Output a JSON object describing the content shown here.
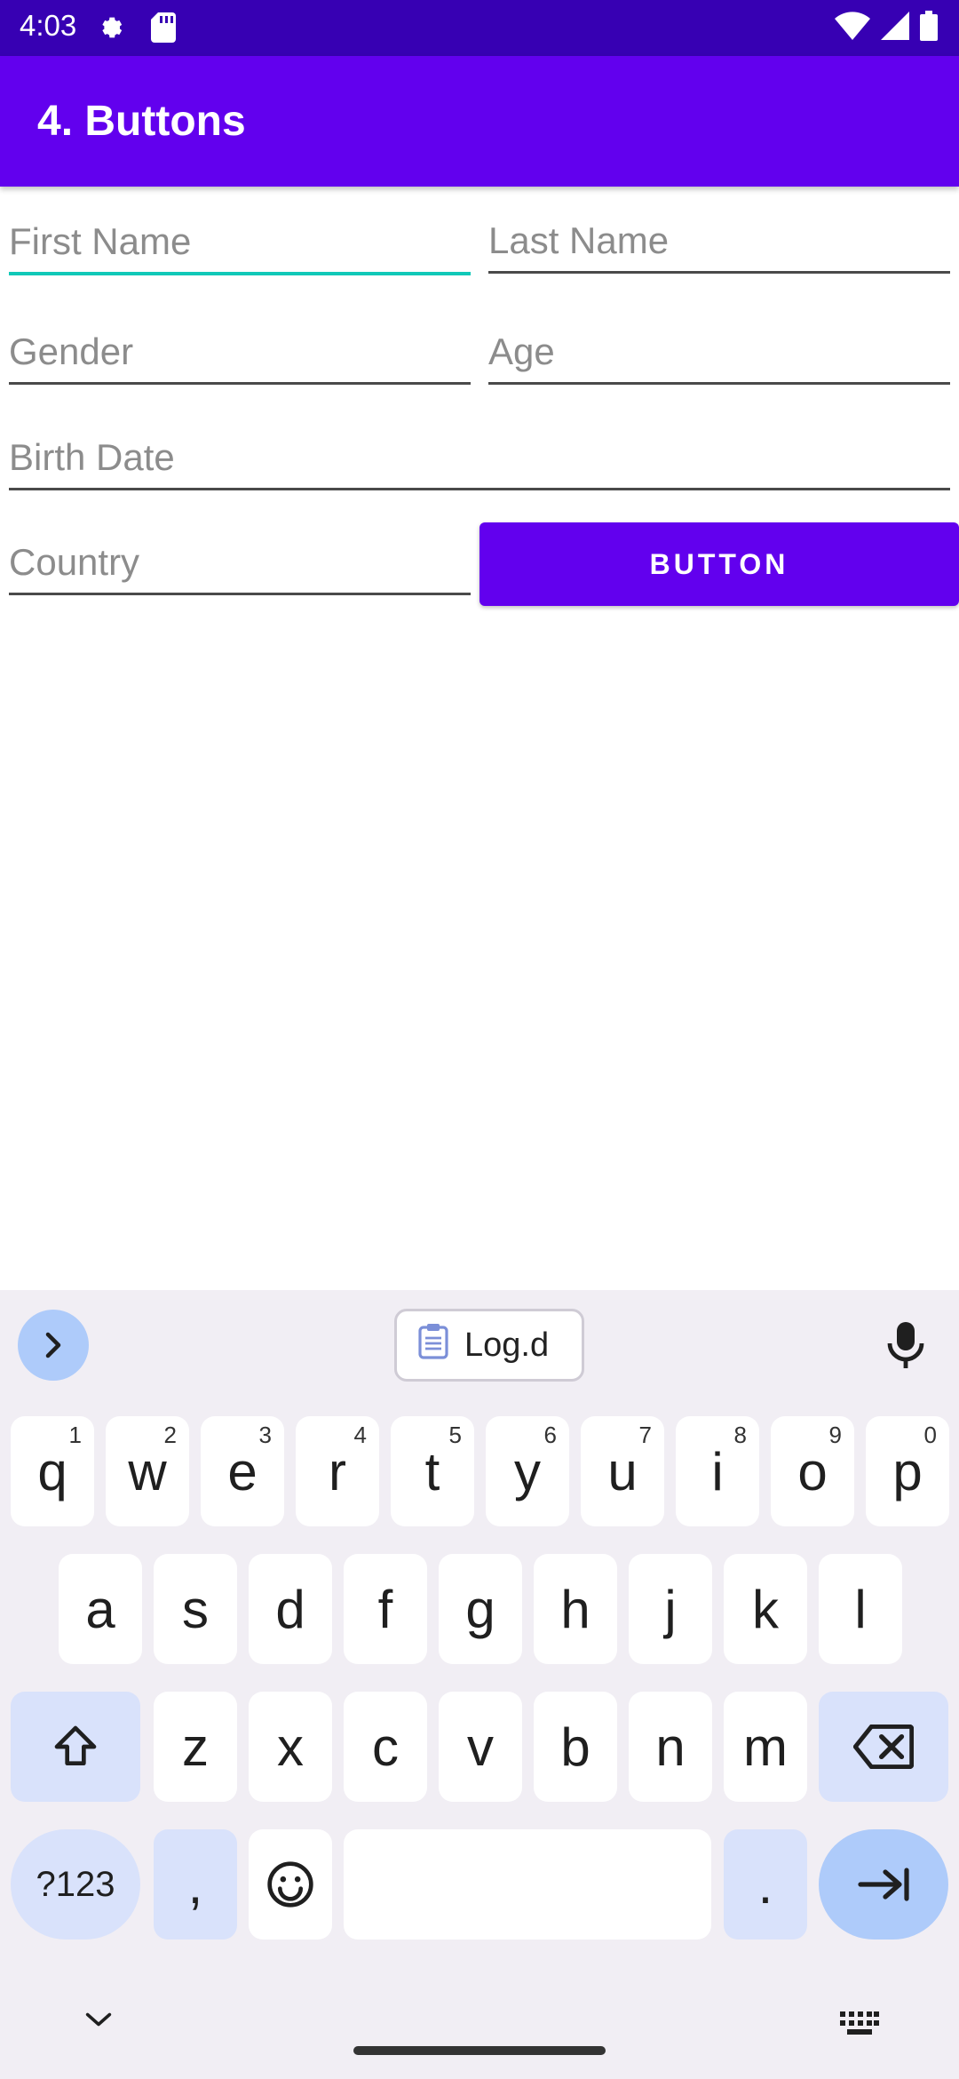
{
  "status_bar": {
    "time": "4:03"
  },
  "app_bar": {
    "title": "4. Buttons"
  },
  "form": {
    "first_name_hint": "First Name",
    "last_name_hint": "Last Name",
    "gender_hint": "Gender",
    "age_hint": "Age",
    "birth_date_hint": "Birth Date",
    "country_hint": "Country",
    "button_label": "BUTTON"
  },
  "keyboard": {
    "clipboard_chip": "Log.d",
    "row1": [
      {
        "k": "q",
        "n": "1"
      },
      {
        "k": "w",
        "n": "2"
      },
      {
        "k": "e",
        "n": "3"
      },
      {
        "k": "r",
        "n": "4"
      },
      {
        "k": "t",
        "n": "5"
      },
      {
        "k": "y",
        "n": "6"
      },
      {
        "k": "u",
        "n": "7"
      },
      {
        "k": "i",
        "n": "8"
      },
      {
        "k": "o",
        "n": "9"
      },
      {
        "k": "p",
        "n": "0"
      }
    ],
    "row2": [
      "a",
      "s",
      "d",
      "f",
      "g",
      "h",
      "j",
      "k",
      "l"
    ],
    "row3": [
      "z",
      "x",
      "c",
      "v",
      "b",
      "n",
      "m"
    ],
    "symbols_key": "?123",
    "comma_key": ",",
    "period_key": "."
  },
  "colors": {
    "status_bar": "#3700B3",
    "primary": "#6200EE",
    "focus_underline": "#10C9B8",
    "keyboard_bg": "#F1EEF4",
    "key_mod": "#D9E2FB"
  }
}
